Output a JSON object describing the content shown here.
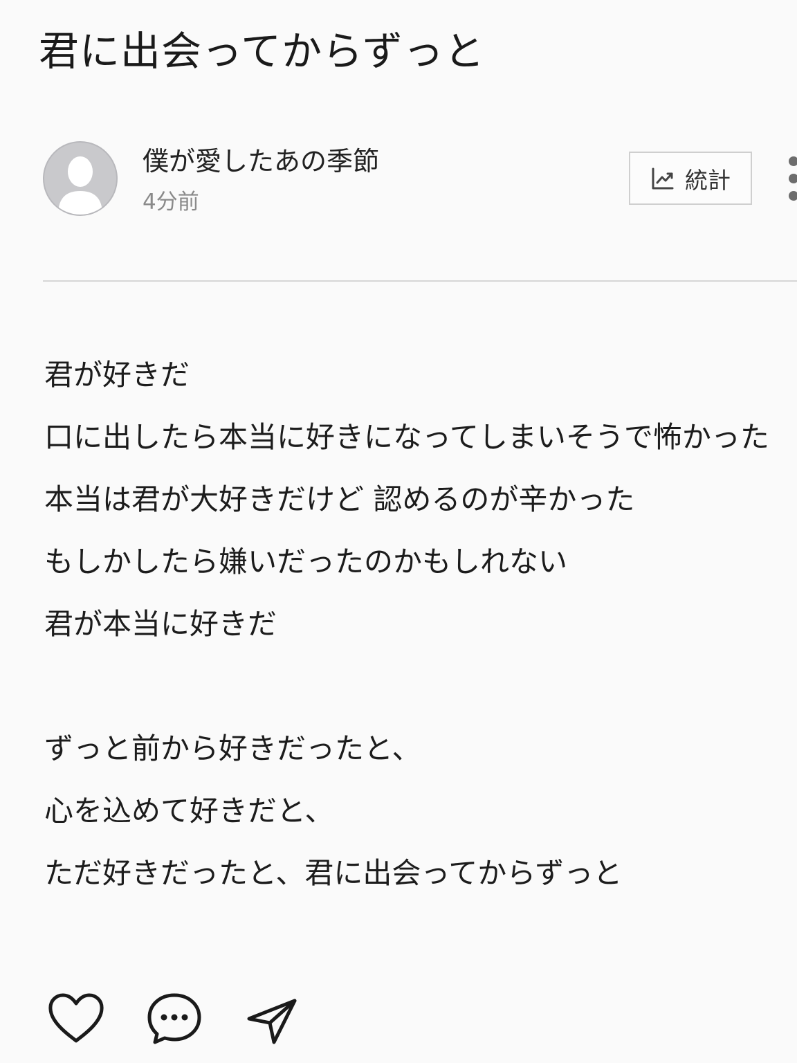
{
  "post": {
    "title": "君に出会ってからずっと",
    "author": {
      "name": "僕が愛したあの季節",
      "time": "4分前"
    },
    "stats_button": {
      "label": "統計",
      "icon": "trending-up-chart-icon"
    },
    "more_icon": "vertical-dots-icon",
    "body_lines": [
      "君が好きだ",
      "口に出したら本当に好きになってしまいそうで怖かった",
      "本当は君が大好きだけど 認めるのが辛かった",
      "もしかしたら嫌いだったのかもしれない",
      "君が本当に好きだ",
      "",
      "ずっと前から好きだったと、",
      "心を込めて好きだと、",
      "ただ好きだったと、君に出会ってからずっと"
    ],
    "actions": [
      {
        "name": "like",
        "icon": "heart-icon"
      },
      {
        "name": "comment",
        "icon": "comment-bubble-icon"
      },
      {
        "name": "share",
        "icon": "send-icon"
      }
    ]
  },
  "colors": {
    "background": "#fafafa",
    "text": "#1c1c1c",
    "muted": "#8a8a8a",
    "avatar": "#c9c9cc",
    "divider": "#d6d6d6"
  }
}
